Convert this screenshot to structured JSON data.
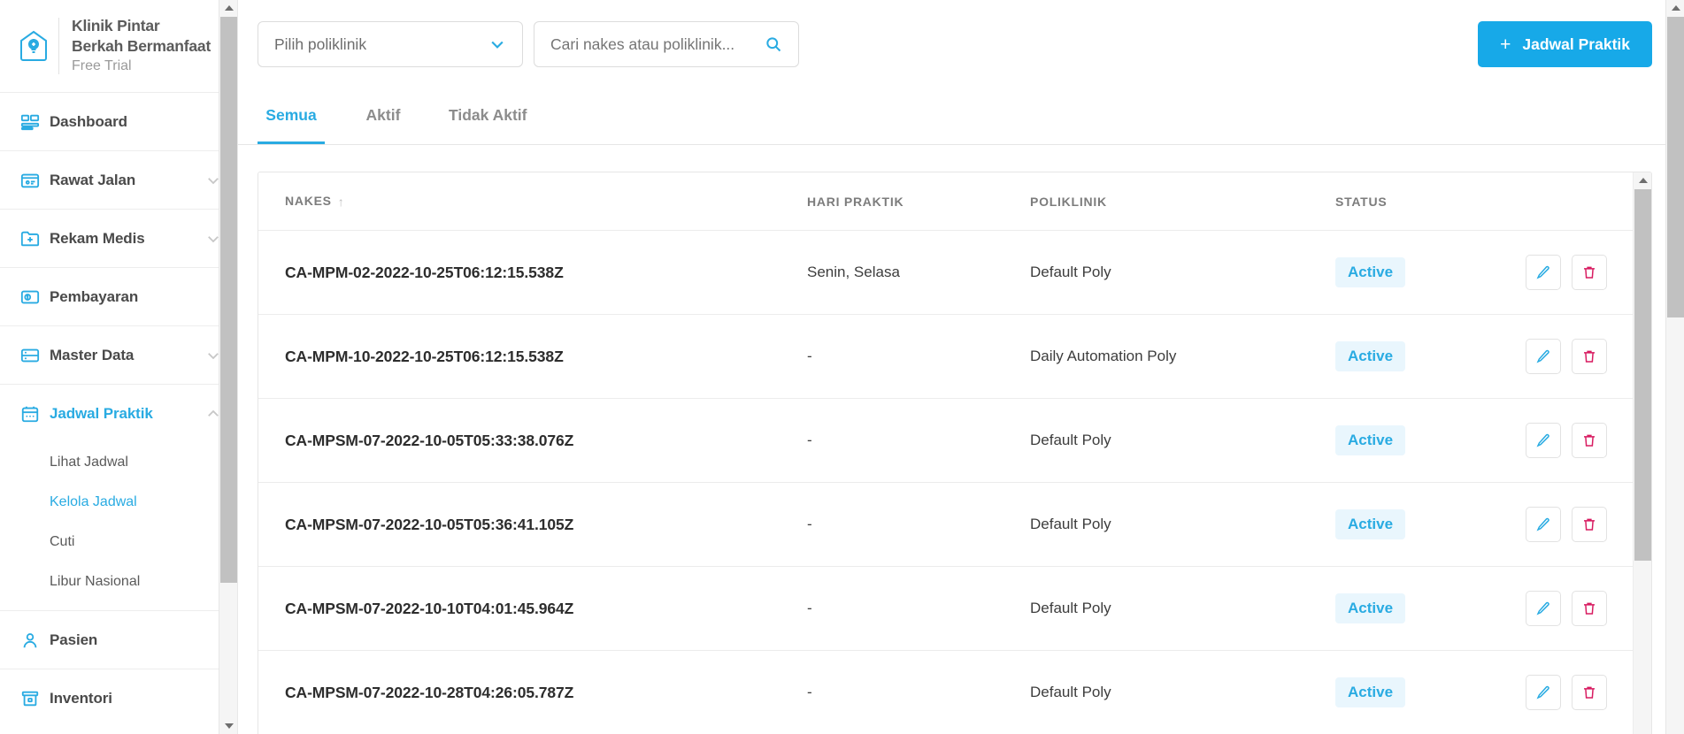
{
  "sidebar": {
    "brand": {
      "name_line1": "Klinik Pintar",
      "name_line2": "Berkah Bermanfaat",
      "plan": "Free Trial",
      "logo_icon": "clinic-pin-icon"
    },
    "items": [
      {
        "label": "Dashboard",
        "icon": "dashboard-icon",
        "expandable": false,
        "active": false
      },
      {
        "label": "Rawat Jalan",
        "icon": "outpatient-card-icon",
        "expandable": true,
        "active": false
      },
      {
        "label": "Rekam Medis",
        "icon": "medical-record-folder-icon",
        "expandable": true,
        "active": false
      },
      {
        "label": "Pembayaran",
        "icon": "payment-wallet-icon",
        "expandable": false,
        "active": false
      },
      {
        "label": "Master Data",
        "icon": "database-icon",
        "expandable": true,
        "active": false
      },
      {
        "label": "Jadwal Praktik",
        "icon": "calendar-icon",
        "expandable": true,
        "active": true
      },
      {
        "label": "Pasien",
        "icon": "patient-person-icon",
        "expandable": false,
        "active": false
      },
      {
        "label": "Inventori",
        "icon": "inventory-box-icon",
        "expandable": false,
        "active": false
      }
    ],
    "submenu": [
      {
        "label": "Lihat Jadwal",
        "active": false
      },
      {
        "label": "Kelola Jadwal",
        "active": true
      },
      {
        "label": "Cuti",
        "active": false
      },
      {
        "label": "Libur Nasional",
        "active": false
      }
    ]
  },
  "toolbar": {
    "poliklinik_select": "Pilih poliklinik",
    "search_placeholder": "Cari nakes atau poliklinik...",
    "search_value": "",
    "search_icon": "search-icon",
    "add_button_label": "Jadwal Praktik",
    "add_button_plus": "+",
    "add_button_color": "#17A9E8"
  },
  "tabs": [
    {
      "label": "Semua",
      "active": true
    },
    {
      "label": "Aktif",
      "active": false
    },
    {
      "label": "Tidak Aktif",
      "active": false
    }
  ],
  "table": {
    "headers": {
      "nakes": "NAKES",
      "sort_glyph": "↑",
      "hari_praktik": "HARI PRAKTIK",
      "poliklinik": "POLIKLINIK",
      "status": "STATUS"
    },
    "rows": [
      {
        "nakes": "CA-MPM-02-2022-10-25T06:12:15.538Z",
        "hari": "Senin, Selasa",
        "poliklinik": "Default Poly",
        "status": "Active"
      },
      {
        "nakes": "CA-MPM-10-2022-10-25T06:12:15.538Z",
        "hari": "-",
        "poliklinik": "Daily Automation Poly",
        "status": "Active"
      },
      {
        "nakes": "CA-MPSM-07-2022-10-05T05:33:38.076Z",
        "hari": "-",
        "poliklinik": "Default Poly",
        "status": "Active"
      },
      {
        "nakes": "CA-MPSM-07-2022-10-05T05:36:41.105Z",
        "hari": "-",
        "poliklinik": "Default Poly",
        "status": "Active"
      },
      {
        "nakes": "CA-MPSM-07-2022-10-10T04:01:45.964Z",
        "hari": "-",
        "poliklinik": "Default Poly",
        "status": "Active"
      },
      {
        "nakes": "CA-MPSM-07-2022-10-28T04:26:05.787Z",
        "hari": "-",
        "poliklinik": "Default Poly",
        "status": "Active"
      }
    ],
    "row_actions": {
      "edit_icon": "pencil-edit-icon",
      "delete_icon": "trash-delete-icon"
    },
    "status_badge_color": "#29ABE2",
    "status_badge_bg": "#e9f6fd",
    "delete_icon_color": "#D81B60"
  }
}
